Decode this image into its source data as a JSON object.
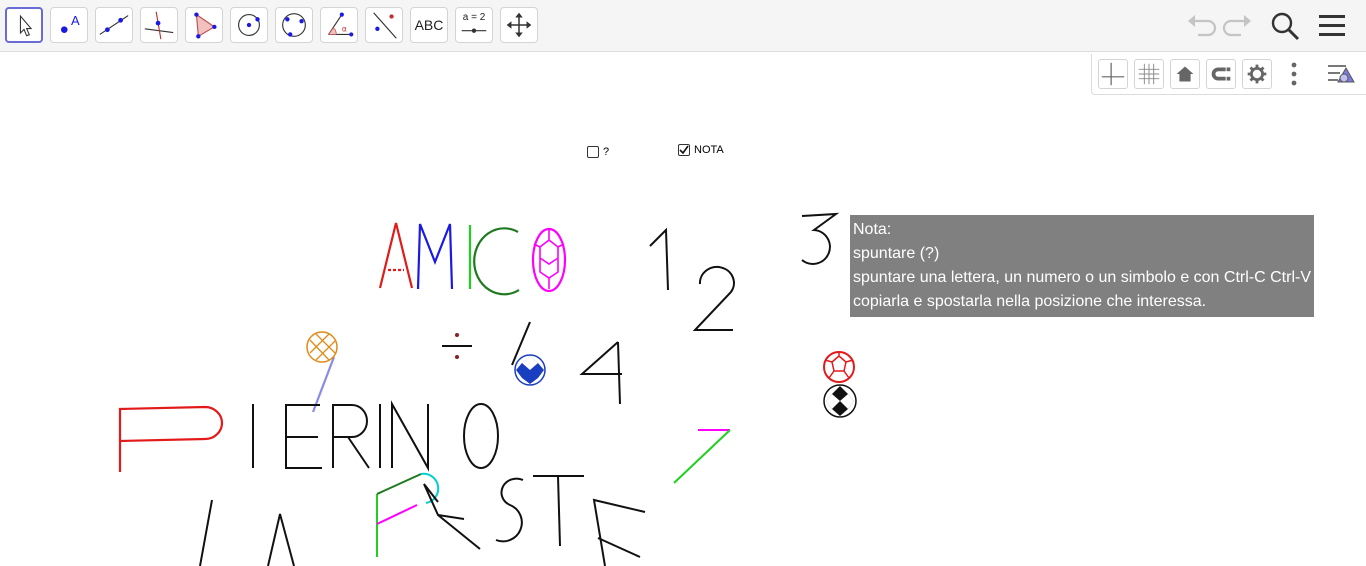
{
  "toolbar": {
    "tools": [
      {
        "name": "move-tool",
        "label": ""
      },
      {
        "name": "point-tool",
        "label": "A"
      },
      {
        "name": "line-tool",
        "label": ""
      },
      {
        "name": "perpendicular-tool",
        "label": ""
      },
      {
        "name": "polygon-tool",
        "label": ""
      },
      {
        "name": "circle-center-tool",
        "label": ""
      },
      {
        "name": "circle-three-points-tool",
        "label": ""
      },
      {
        "name": "angle-tool",
        "label": ""
      },
      {
        "name": "reflect-tool",
        "label": ""
      },
      {
        "name": "text-tool",
        "label": "ABC"
      },
      {
        "name": "slider-tool",
        "label": "a = 2"
      },
      {
        "name": "move-graphics-tool",
        "label": ""
      }
    ],
    "accent": "#6b6bd6"
  },
  "checkboxes": {
    "question": {
      "label": "?",
      "checked": false
    },
    "nota": {
      "label": "NOTA",
      "checked": true
    }
  },
  "note": {
    "lines": [
      "Nota:",
      "spuntare (?)",
      "spuntare una lettera, un numero o un simbolo e con Ctrl-C Ctrl-V",
      "copiarla e spostarla nella posizione che interessa."
    ],
    "background": "#808080"
  },
  "colors": {
    "red": "#e31a1a",
    "blue": "#1a1ae3",
    "green": "#1fd11f",
    "dark_green": "#1e7a1e",
    "magenta": "#ff00ff",
    "orange": "#e08a1a",
    "navy": "#1a3ec0"
  }
}
